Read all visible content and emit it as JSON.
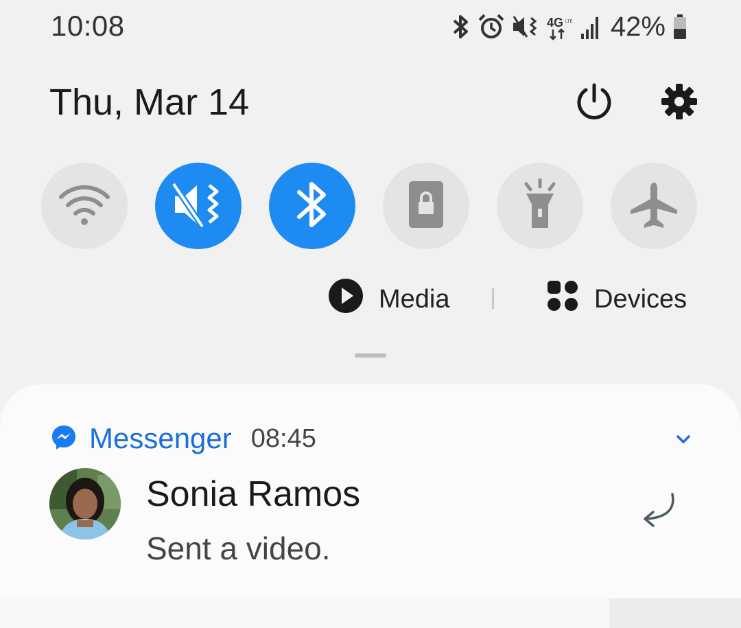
{
  "status_bar": {
    "time": "10:08",
    "battery": "42%",
    "icons": [
      "bluetooth-icon",
      "alarm-icon",
      "vibrate-icon",
      "4g-lte-icon",
      "signal-icon",
      "battery-icon"
    ]
  },
  "header": {
    "date": "Thu, Mar 14",
    "power_icon": "power-icon",
    "settings_icon": "gear-icon"
  },
  "quick_tiles": [
    {
      "name": "wifi",
      "icon": "wifi-icon",
      "state": "off"
    },
    {
      "name": "sound",
      "icon": "vibrate-icon",
      "state": "on"
    },
    {
      "name": "bluetooth",
      "icon": "bluetooth-icon",
      "state": "on"
    },
    {
      "name": "screen-lock",
      "icon": "lock-icon",
      "state": "off"
    },
    {
      "name": "flashlight",
      "icon": "flashlight-icon",
      "state": "off"
    },
    {
      "name": "airplane",
      "icon": "airplane-icon",
      "state": "off"
    }
  ],
  "media_row": {
    "media_label": "Media",
    "devices_label": "Devices"
  },
  "notification": {
    "app": "Messenger",
    "time": "08:45",
    "sender": "Sonia Ramos",
    "message": "Sent a video."
  },
  "colors": {
    "accent": "#1d8bf1",
    "messenger": "#1b6fd9",
    "tile_off": "#e4e4e4",
    "background": "#f1f1f1"
  }
}
